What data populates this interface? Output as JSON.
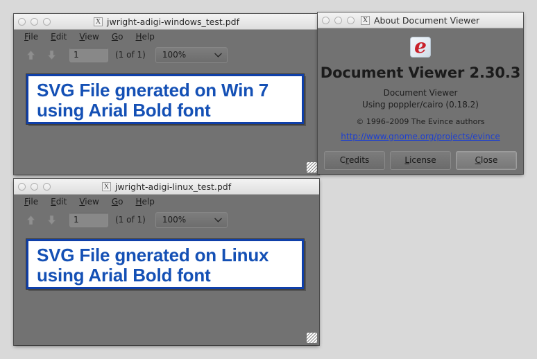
{
  "desktop": {
    "background": "#d9d9d9"
  },
  "windows": [
    {
      "id": "windows-test",
      "title": "jwright-adigi-windows_test.pdf",
      "title_icon": "X",
      "menus": [
        {
          "pre": "",
          "mnemonic": "F",
          "post": "ile"
        },
        {
          "pre": "",
          "mnemonic": "E",
          "post": "dit"
        },
        {
          "pre": "",
          "mnemonic": "V",
          "post": "iew"
        },
        {
          "pre": "",
          "mnemonic": "G",
          "post": "o"
        },
        {
          "pre": "",
          "mnemonic": "H",
          "post": "elp"
        }
      ],
      "toolbar": {
        "page_value": "1",
        "page_total": "(1 of 1)",
        "zoom_value": "100%"
      },
      "page_lines": [
        "SVG File gnerated on Win 7",
        "using Arial Bold font"
      ]
    },
    {
      "id": "linux-test",
      "title": "jwright-adigi-linux_test.pdf",
      "title_icon": "X",
      "menus": [
        {
          "pre": "",
          "mnemonic": "F",
          "post": "ile"
        },
        {
          "pre": "",
          "mnemonic": "E",
          "post": "dit"
        },
        {
          "pre": "",
          "mnemonic": "V",
          "post": "iew"
        },
        {
          "pre": "",
          "mnemonic": "G",
          "post": "o"
        },
        {
          "pre": "",
          "mnemonic": "H",
          "post": "elp"
        }
      ],
      "toolbar": {
        "page_value": "1",
        "page_total": "(1 of 1)",
        "zoom_value": "100%"
      },
      "page_lines": [
        "SVG File gnerated on Linux",
        "using Arial Bold font"
      ]
    }
  ],
  "about_dialog": {
    "title": "About Document Viewer",
    "title_icon": "X",
    "logo_glyph": "e",
    "app_title": "Document Viewer 2.30.3",
    "app_name": "Document Viewer",
    "backend": "Using poppler/cairo (0.18.2)",
    "copyright": "© 1996–2009 The Evince authors",
    "website": "http://www.gnome.org/projects/evince",
    "buttons": [
      {
        "pre": "C",
        "mnemonic": "r",
        "post": "edits"
      },
      {
        "pre": "",
        "mnemonic": "L",
        "post": "icense"
      },
      {
        "pre": "",
        "mnemonic": "C",
        "post": "lose"
      }
    ]
  },
  "colors": {
    "window_body": "#727272",
    "titlebar": "#eaeaea",
    "desktop": "#d9d9d9",
    "pdf_text": "#1450b5",
    "pdf_border": "#0f3fa8",
    "link": "#1d3fd0",
    "logo_red": "#c9202a"
  }
}
